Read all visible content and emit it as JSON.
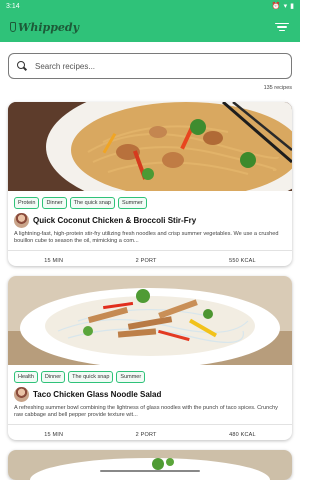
{
  "status_bar": {
    "time": "3:14",
    "battery_level_pct": 100
  },
  "app_bar": {
    "logo_text": "Whippedy"
  },
  "search": {
    "placeholder": "Search recipes..."
  },
  "results": {
    "count_text": "135 recipes"
  },
  "recipes": [
    {
      "tags": [
        "Protein",
        "Dinner",
        "The quick snap",
        "Summer"
      ],
      "title": "Quick Coconut Chicken & Broccoli Stir-Fry",
      "description": "A lightning-fast, high-protein stir-fry utilizing fresh noodles and crisp summer vegetables. We use a crushed bouillon cube to season the oil, mimicking a com...",
      "time": "15 MIN",
      "portions": "2 PORT",
      "calories": "550 KCAL"
    },
    {
      "tags": [
        "Health",
        "Dinner",
        "The quick snap",
        "Summer"
      ],
      "title": "Taco Chicken Glass Noodle Salad",
      "description": "A refreshing summer bowl combining the lightness of glass noodles with the punch of taco spices. Crunchy raw cabbage and bell pepper provide texture wit...",
      "time": "15 MIN",
      "portions": "2 PORT",
      "calories": "480 KCAL"
    }
  ],
  "colors": {
    "brand": "#2fc279",
    "tag_border": "#2fc279"
  },
  "icons": {
    "search": "search-icon",
    "filter": "filter-icon"
  }
}
